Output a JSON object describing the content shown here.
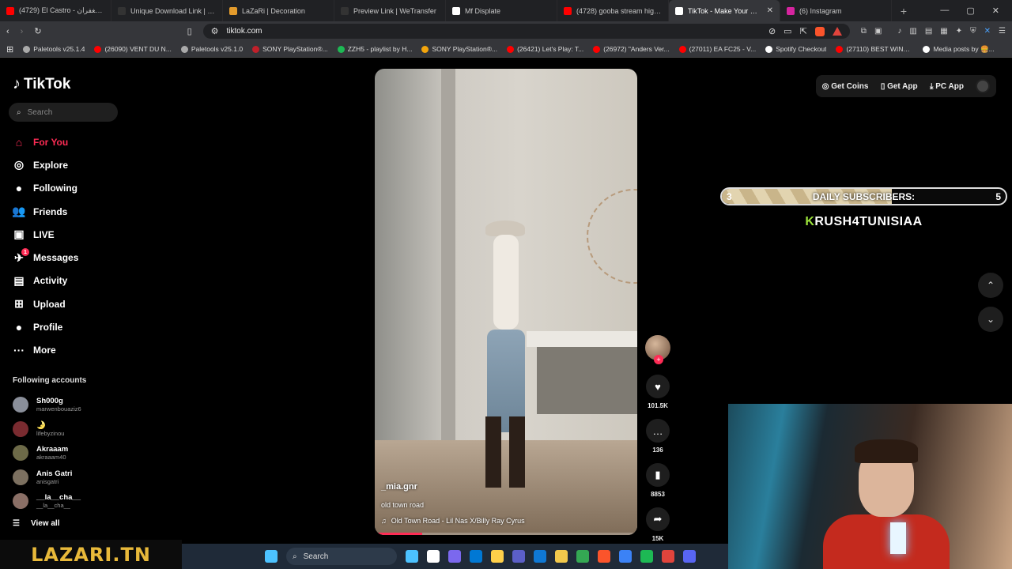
{
  "browser": {
    "tabs": [
      {
        "title": "(4729) El Castro - رسالة الغفران",
        "color": "#ff0000"
      },
      {
        "title": "Unique Download Link | WeTra",
        "color": "#333333"
      },
      {
        "title": "LaZaRi | Decoration",
        "color": "#e39b2c"
      },
      {
        "title": "Preview Link | WeTransfer",
        "color": "#333333"
      },
      {
        "title": "Mf Displate",
        "color": "#ffffff"
      },
      {
        "title": "(4728) gooba stream highlight",
        "color": "#ff0000"
      },
      {
        "title": "TikTok - Make Your Day",
        "color": "#ffffff",
        "active": true
      },
      {
        "title": "(6) Instagram",
        "color": "#d6249f"
      }
    ],
    "url": "tiktok.com",
    "bookmarks": [
      {
        "title": "Paletools v25.1.4",
        "color": "#aaaaaa"
      },
      {
        "title": "(26090) VENT DU N...",
        "color": "#ff0000"
      },
      {
        "title": "Paletools v25.1.0",
        "color": "#aaaaaa"
      },
      {
        "title": "SONY PlayStation®...",
        "color": "#c0202a"
      },
      {
        "title": "ZZH5 - playlist by H...",
        "color": "#1db954"
      },
      {
        "title": "SONY PlayStation®...",
        "color": "#f3a50c"
      },
      {
        "title": "(26421) Let's Play: T...",
        "color": "#ff0000"
      },
      {
        "title": "(26972) \"Anders Ver...",
        "color": "#ff0000"
      },
      {
        "title": "(27011) EA FC25 - V...",
        "color": "#ff0000"
      },
      {
        "title": "Spotify Checkout",
        "color": "#ffffff"
      },
      {
        "title": "(27110) BEST WING...",
        "color": "#ff0000"
      },
      {
        "title": "Media posts by 🍔...",
        "color": "#ffffff"
      }
    ]
  },
  "tiktok": {
    "logo": "TikTok",
    "search_placeholder": "Search",
    "nav": [
      {
        "label": "For You",
        "icon": "home-icon",
        "glyph": "⌂",
        "active": true
      },
      {
        "label": "Explore",
        "icon": "compass-icon",
        "glyph": "◎"
      },
      {
        "label": "Following",
        "icon": "following-avatar-icon",
        "glyph": "●"
      },
      {
        "label": "Friends",
        "icon": "friends-icon",
        "glyph": "👥"
      },
      {
        "label": "LIVE",
        "icon": "live-icon",
        "glyph": "▣"
      },
      {
        "label": "Messages",
        "icon": "messages-icon",
        "glyph": "✈",
        "badge": "1"
      },
      {
        "label": "Activity",
        "icon": "activity-icon",
        "glyph": "▤"
      },
      {
        "label": "Upload",
        "icon": "upload-icon",
        "glyph": "⊞"
      },
      {
        "label": "Profile",
        "icon": "profile-icon",
        "glyph": "●"
      },
      {
        "label": "More",
        "icon": "more-icon",
        "glyph": "···"
      }
    ],
    "following_title": "Following accounts",
    "following": [
      {
        "name": "Sh000g",
        "handle": "marwenbouaziz6",
        "color": "#8a8f9a"
      },
      {
        "name": "🌛",
        "handle": "lifebyzinou",
        "color": "#7a2b30"
      },
      {
        "name": "Akraaam",
        "handle": "akraaam40",
        "color": "#6d6a48"
      },
      {
        "name": "Anis Gatri",
        "handle": "anisgatri",
        "color": "#7c7060"
      },
      {
        "name": "__la__cha__",
        "handle": "__la__cha__",
        "color": "#8a6f66"
      }
    ],
    "view_all": "View all",
    "header_buttons": {
      "coins": "Get Coins",
      "app": "Get App",
      "pc": "PC App"
    },
    "video": {
      "username": "_mia.gnr",
      "caption": "old town road",
      "music": "Old Town Road - Lil Nas X/Billy Ray Cyrus",
      "progress": 0.18
    },
    "actions": {
      "likes": "101.5K",
      "comments": "136",
      "saves": "8853",
      "shares": "15K"
    }
  },
  "overlay": {
    "subs_left": "3",
    "subs_label": "DAILY SUBSCRIBERS:",
    "subs_right": "5",
    "subs_progress": 0.6,
    "channel_first": "K",
    "channel_rest": "RUSH4TUNISIAA",
    "watermark": "LAZARI.TN"
  },
  "taskbar": {
    "search_label": "Search",
    "apps": [
      "#4cc2ff",
      "#ffffff",
      "#7b68ee",
      "#0078d4",
      "#ffd04a",
      "#5b5fc7",
      "#0f78d4",
      "#f2c94c",
      "#34a853",
      "#fb542b",
      "#3b82f6",
      "#1db954",
      "#e0443c",
      "#5865f2"
    ]
  }
}
